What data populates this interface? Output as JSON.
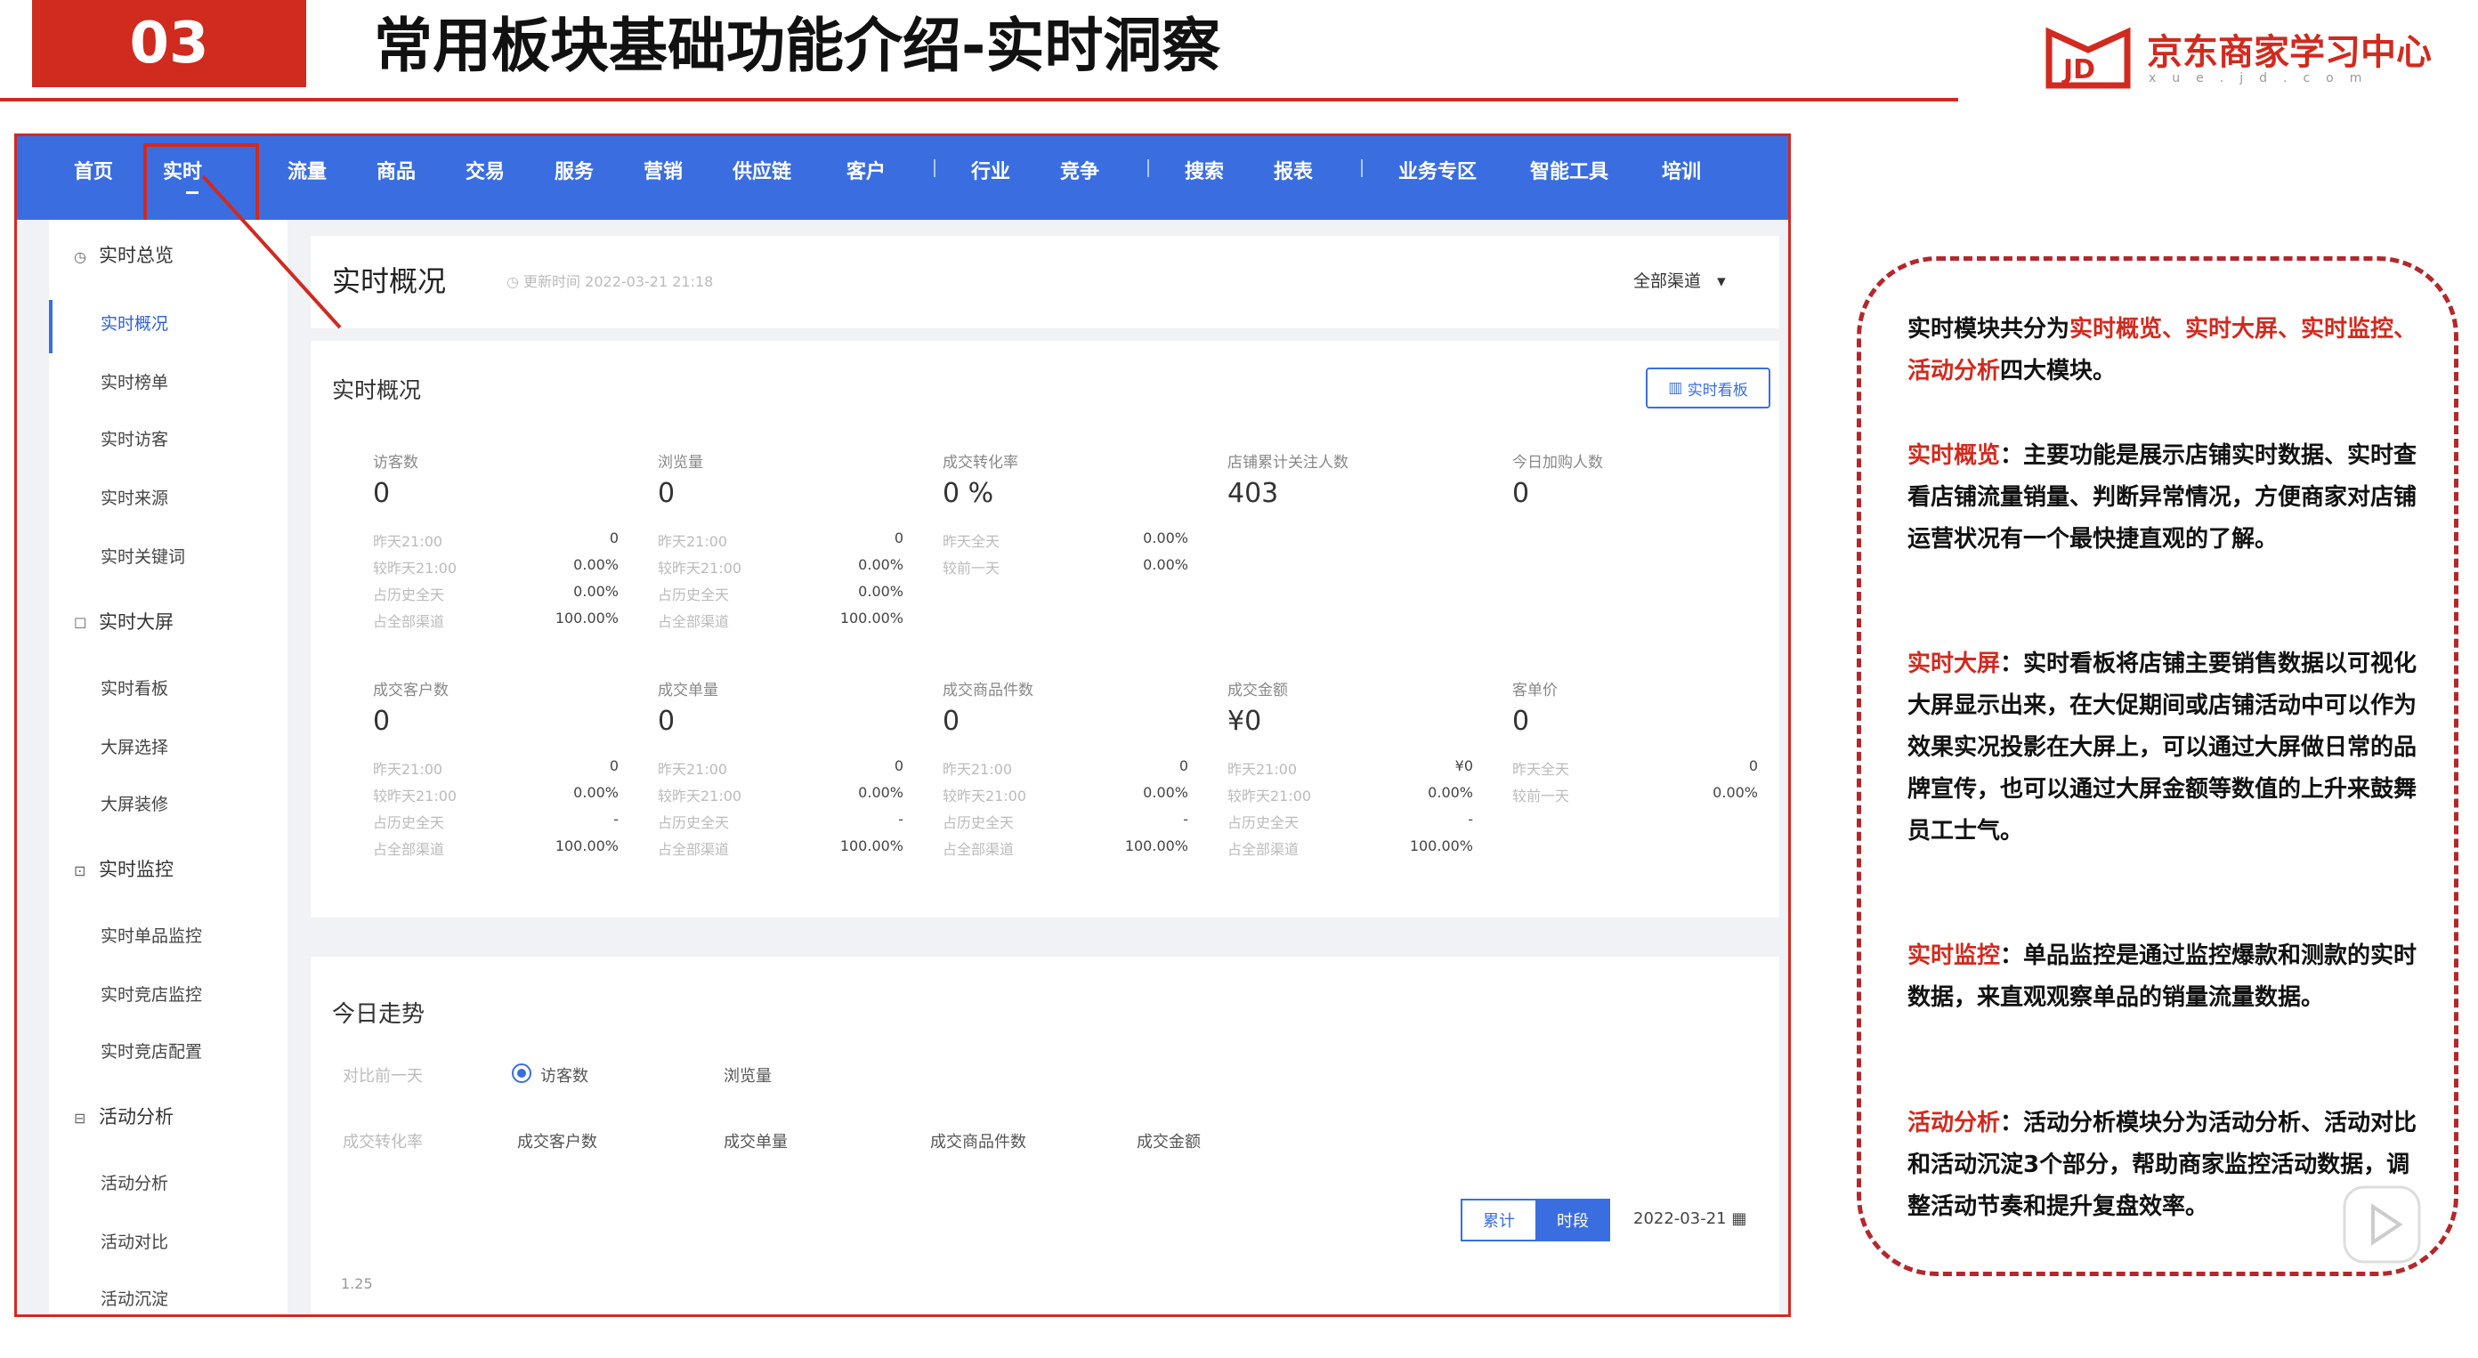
{
  "slide": {
    "number": "03",
    "title": "常用板块基础功能介绍-实时洞察",
    "logo_text": "京东商家学习中心",
    "logo_sub": "xue.jd.com"
  },
  "topnav": {
    "items": [
      "首页",
      "实时",
      "流量",
      "商品",
      "交易",
      "服务",
      "营销",
      "供应链",
      "客户",
      "行业",
      "竞争",
      "搜索",
      "报表",
      "业务专区",
      "智能工具",
      "培训"
    ],
    "active": "实时"
  },
  "sidebar": {
    "groups": [
      {
        "label": "实时总览",
        "icon": "clock-icon",
        "items": [
          "实时概况",
          "实时榜单",
          "实时访客",
          "实时来源",
          "实时关键词"
        ]
      },
      {
        "label": "实时大屏",
        "icon": "monitor-icon",
        "items": [
          "实时看板",
          "大屏选择",
          "大屏装修"
        ]
      },
      {
        "label": "实时监控",
        "icon": "monitor-icon",
        "items": [
          "实时单品监控",
          "实时竞店监控",
          "实时竞店配置"
        ]
      },
      {
        "label": "活动分析",
        "icon": "chart-icon",
        "items": [
          "活动分析",
          "活动对比",
          "活动沉淀"
        ]
      }
    ],
    "active_item": "实时概况"
  },
  "titlebar": {
    "title": "实时概况",
    "update_label": "更新时间",
    "update_time": "2022-03-21 21:18",
    "channel": "全部渠道"
  },
  "realtime_card": {
    "title": "实时概况",
    "board_button": "实时看板",
    "metrics": [
      {
        "label": "访客数",
        "value": "0",
        "rows": [
          [
            "昨天21:00",
            "0"
          ],
          [
            "较昨天21:00",
            "0.00%"
          ],
          [
            "占历史全天",
            "0.00%"
          ],
          [
            "占全部渠道",
            "100.00%"
          ]
        ]
      },
      {
        "label": "浏览量",
        "value": "0",
        "rows": [
          [
            "昨天21:00",
            "0"
          ],
          [
            "较昨天21:00",
            "0.00%"
          ],
          [
            "占历史全天",
            "0.00%"
          ],
          [
            "占全部渠道",
            "100.00%"
          ]
        ]
      },
      {
        "label": "成交转化率",
        "value": "0 %",
        "rows": [
          [
            "昨天全天",
            "0.00%"
          ],
          [
            "较前一天",
            "0.00%"
          ]
        ]
      },
      {
        "label": "店铺累计关注人数",
        "value": "403",
        "rows": []
      },
      {
        "label": "今日加购人数",
        "value": "0",
        "rows": []
      },
      {
        "label": "成交客户数",
        "value": "0",
        "rows": [
          [
            "昨天21:00",
            "0"
          ],
          [
            "较昨天21:00",
            "0.00%"
          ],
          [
            "占历史全天",
            "-"
          ],
          [
            "占全部渠道",
            "100.00%"
          ]
        ]
      },
      {
        "label": "成交单量",
        "value": "0",
        "rows": [
          [
            "昨天21:00",
            "0"
          ],
          [
            "较昨天21:00",
            "0.00%"
          ],
          [
            "占历史全天",
            "-"
          ],
          [
            "占全部渠道",
            "100.00%"
          ]
        ]
      },
      {
        "label": "成交商品件数",
        "value": "0",
        "rows": [
          [
            "昨天21:00",
            "0"
          ],
          [
            "较昨天21:00",
            "0.00%"
          ],
          [
            "占历史全天",
            "-"
          ],
          [
            "占全部渠道",
            "100.00%"
          ]
        ]
      },
      {
        "label": "成交金额",
        "value": "¥0",
        "rows": [
          [
            "昨天21:00",
            "¥0"
          ],
          [
            "较昨天21:00",
            "0.00%"
          ],
          [
            "占历史全天",
            "-"
          ],
          [
            "占全部渠道",
            "100.00%"
          ]
        ]
      },
      {
        "label": "客单价",
        "value": "0",
        "rows": [
          [
            "昨天全天",
            "0"
          ],
          [
            "较前一天",
            "0.00%"
          ]
        ]
      }
    ]
  },
  "trend_card": {
    "title": "今日走势",
    "compare_label": "对比前一天",
    "options_row1": [
      "访客数",
      "浏览量"
    ],
    "options_row2": [
      "成交转化率",
      "成交客户数",
      "成交单量",
      "成交商品件数",
      "成交金额"
    ],
    "selected": "访客数",
    "seg_cumulative": "累计",
    "seg_period": "时段",
    "date": "2022-03-21",
    "axis_tick": "1.25"
  },
  "explanation": {
    "p1": {
      "prefix": "实时模块共分为",
      "hl": "实时概览、实时大屏、实时监控、活动分析",
      "suffix": "四大模块。"
    },
    "p2": {
      "hl": "实时概览",
      "text": "：主要功能是展示店铺实时数据、实时查看店铺流量销量、判断异常情况，方便商家对店铺运营状况有一个最快捷直观的了解。"
    },
    "p3": {
      "hl": "实时大屏",
      "text": "：实时看板将店铺主要销售数据以可视化大屏显示出来，在大促期间或店铺活动中可以作为效果实况投影在大屏上，可以通过大屏做日常的品牌宣传，也可以通过大屏金额等数值的上升来鼓舞员工士气。"
    },
    "p4": {
      "hl": "实时监控",
      "text": "：单品监控是通过监控爆款和测款的实时数据，来直观观察单品的销量流量数据。"
    },
    "p5": {
      "hl": "活动分析",
      "text": "：活动分析模块分为活动分析、活动对比和活动沉淀3个部分，帮助商家监控活动数据，调整活动节奏和提升复盘效率。"
    }
  },
  "colors": {
    "brand_red": "#d12a1f",
    "nav_blue": "#3a6ee0"
  }
}
